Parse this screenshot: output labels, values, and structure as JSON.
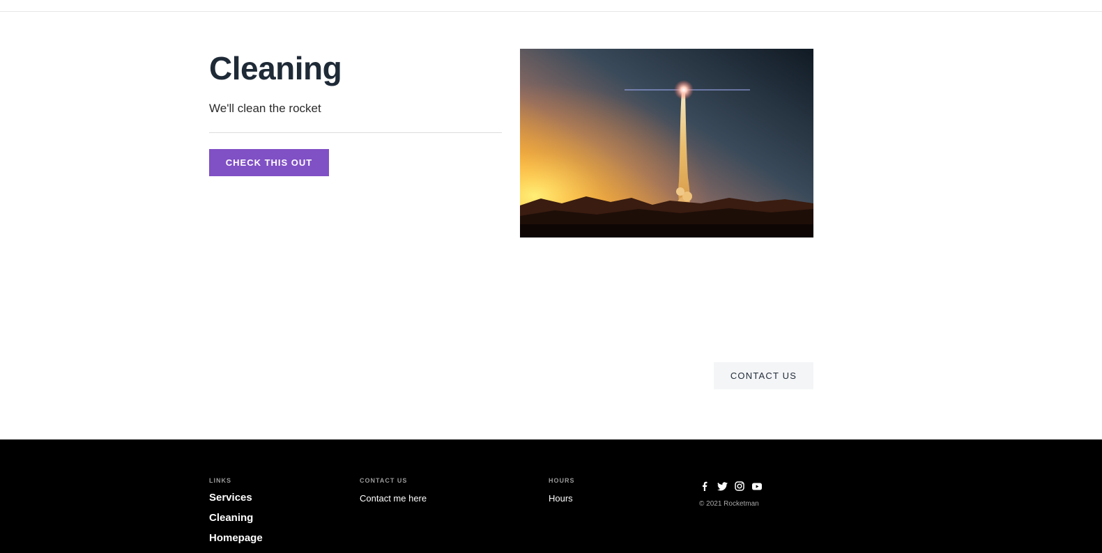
{
  "hero": {
    "title": "Cleaning",
    "subtitle": "We'll clean the rocket",
    "cta_label": "CHECK THIS OUT",
    "image_icon": "rocket-launch-photo"
  },
  "contact_button": {
    "label": "CONTACT US"
  },
  "footer": {
    "links": {
      "heading": "LINKS",
      "items": [
        "Services",
        "Cleaning",
        "Homepage"
      ]
    },
    "contact": {
      "heading": "CONTACT US",
      "link": "Contact me here"
    },
    "hours": {
      "heading": "HOURS",
      "link": "Hours"
    },
    "social_icons": [
      "facebook-icon",
      "twitter-icon",
      "instagram-icon",
      "youtube-icon"
    ],
    "copyright": "© 2021 Rocketman"
  },
  "colors": {
    "accent": "#8050c5",
    "heading": "#1f2a37",
    "footer_bg": "#000000",
    "secondary_button_bg": "#f4f5f7"
  }
}
